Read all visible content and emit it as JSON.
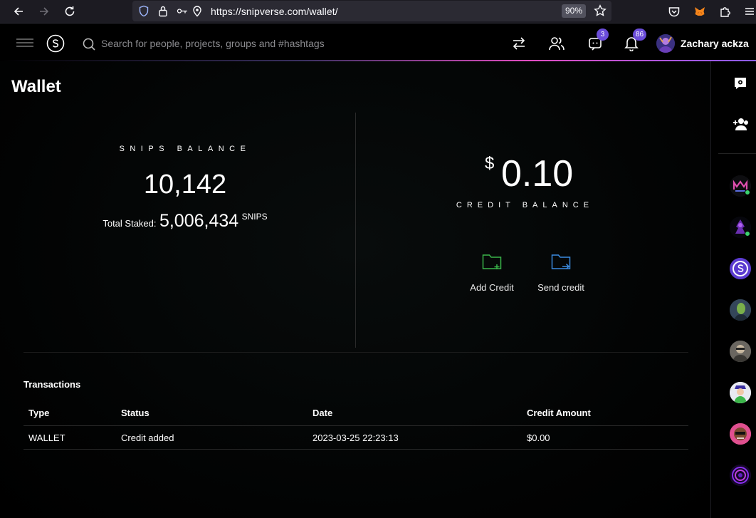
{
  "browser": {
    "url": "https://snipverse.com/wallet/",
    "zoom": "90%"
  },
  "header": {
    "search_placeholder": "Search for people, projects, groups and #hashtags",
    "messages_count": "3",
    "notifications_count": "86",
    "user_name": "Zachary ackza"
  },
  "page": {
    "title": "Wallet"
  },
  "snips": {
    "label": "SNIPS BALANCE",
    "value": "10,142",
    "staked_label": "Total Staked:",
    "staked_value": "5,006,434",
    "staked_unit": "SNIPS"
  },
  "credit": {
    "currency": "$",
    "value": "0.10",
    "label": "CREDIT BALANCE",
    "add_label": "Add Credit",
    "send_label": "Send credit"
  },
  "transactions": {
    "title": "Transactions",
    "columns": [
      "Type",
      "Status",
      "Date",
      "Credit Amount"
    ],
    "rows": [
      [
        "WALLET",
        "Credit added",
        "2023-03-25 22:23:13",
        "$0.00"
      ]
    ]
  },
  "colors": {
    "accent": "#6b4dd9",
    "add_icon": "#3bb54a",
    "send_icon": "#3b8be0"
  }
}
